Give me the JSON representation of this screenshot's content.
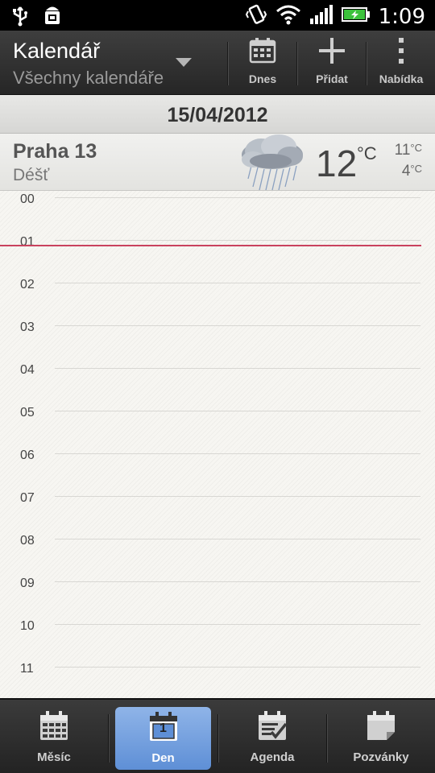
{
  "status_bar": {
    "time": "1:09",
    "icons": [
      "usb-icon",
      "android-debug-icon",
      "vibrate-icon",
      "wifi-icon",
      "signal-icon",
      "battery-charging-icon"
    ]
  },
  "action_bar": {
    "title": "Kalendář",
    "subtitle": "Všechny kalendáře",
    "buttons": [
      {
        "label": "Dnes",
        "icon": "calendar-today-icon"
      },
      {
        "label": "Přidat",
        "icon": "plus-icon"
      },
      {
        "label": "Nabídka",
        "icon": "menu-dots-icon"
      }
    ]
  },
  "date_header": "15/04/2012",
  "weather": {
    "city": "Praha 13",
    "condition": "Déšť",
    "temp": "12",
    "unit": "°C",
    "high": "11",
    "low": "4",
    "deg_unit": "°C"
  },
  "hours": [
    "00",
    "01",
    "02",
    "03",
    "04",
    "05",
    "06",
    "07",
    "08",
    "09",
    "10",
    "11"
  ],
  "tabs": [
    {
      "label": "Měsíc",
      "icon": "month-calendar-icon",
      "active": false
    },
    {
      "label": "Den",
      "icon": "day-calendar-icon",
      "active": true,
      "badge": "1"
    },
    {
      "label": "Agenda",
      "icon": "agenda-icon",
      "active": false
    },
    {
      "label": "Pozvánky",
      "icon": "invitations-icon",
      "active": false
    }
  ],
  "colors": {
    "now_indicator": "#c9425e",
    "active_tab": "#6f9ade"
  }
}
